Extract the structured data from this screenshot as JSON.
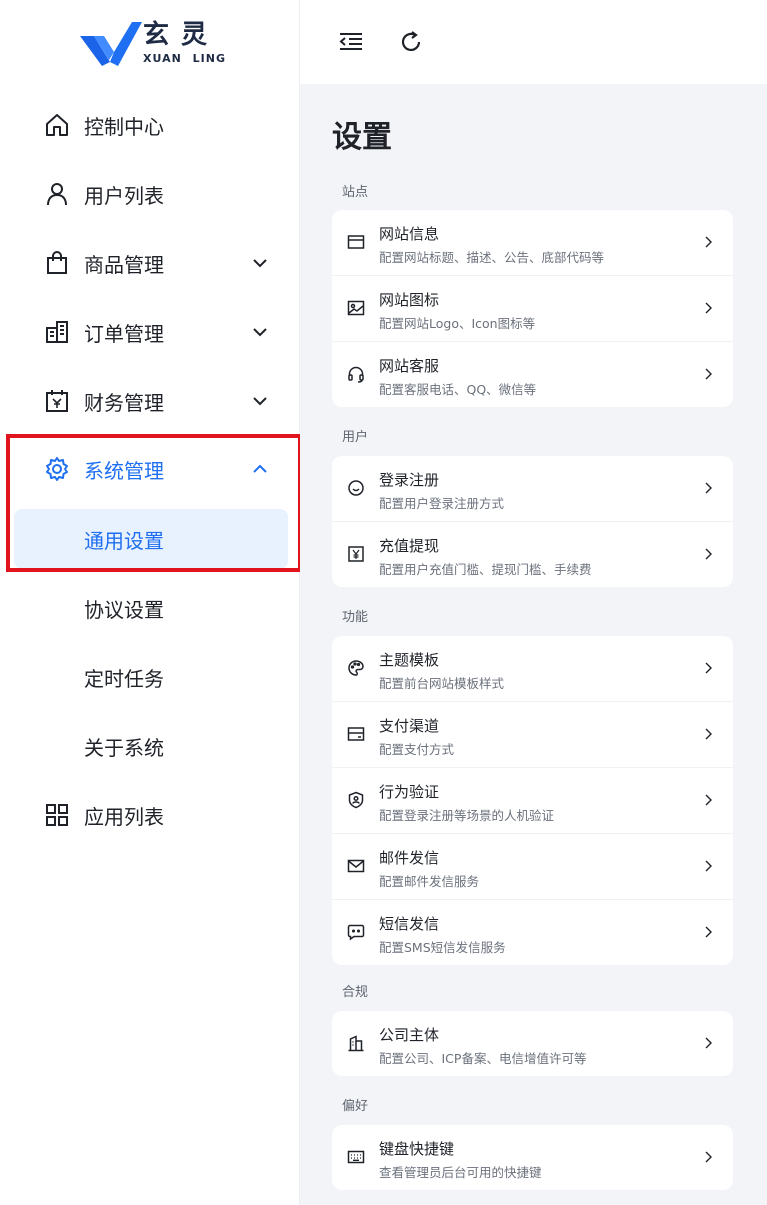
{
  "brand": {
    "cn": "玄灵",
    "en_left": "XUAN",
    "en_right": "LING",
    "color": "#1e6ff1"
  },
  "sidebar": {
    "items": [
      {
        "label": "控制中心",
        "icon": "home-icon"
      },
      {
        "label": "用户列表",
        "icon": "user-icon"
      },
      {
        "label": "商品管理",
        "icon": "shopping-bag-icon",
        "expandable": true
      },
      {
        "label": "订单管理",
        "icon": "building-icon",
        "expandable": true
      },
      {
        "label": "财务管理",
        "icon": "calendar-yen-icon",
        "expandable": true
      },
      {
        "label": "系统管理",
        "icon": "gear-icon",
        "expandable": true,
        "expanded": true
      },
      {
        "label": "应用列表",
        "icon": "grid-icon"
      }
    ],
    "system_sub": [
      {
        "label": "通用设置",
        "selected": true
      },
      {
        "label": "协议设置"
      },
      {
        "label": "定时任务"
      },
      {
        "label": "关于系统"
      }
    ]
  },
  "topbar": {
    "collapse_icon": "menu-collapse-icon",
    "refresh_icon": "refresh-icon"
  },
  "page": {
    "title": "设置"
  },
  "sections": [
    {
      "label": "站点",
      "rows": [
        {
          "title": "网站信息",
          "desc": "配置网站标题、描述、公告、底部代码等",
          "icon": "browser-window-icon"
        },
        {
          "title": "网站图标",
          "desc": "配置网站Logo、Icon图标等",
          "icon": "image-icon"
        },
        {
          "title": "网站客服",
          "desc": "配置客服电话、QQ、微信等",
          "icon": "headset-icon"
        }
      ]
    },
    {
      "label": "用户",
      "rows": [
        {
          "title": "登录注册",
          "desc": "配置用户登录注册方式",
          "icon": "smile-icon"
        },
        {
          "title": "充值提现",
          "desc": "配置用户充值门槛、提现门槛、手续费",
          "icon": "yen-icon"
        }
      ]
    },
    {
      "label": "功能",
      "rows": [
        {
          "title": "主题模板",
          "desc": "配置前台网站模板样式",
          "icon": "palette-icon"
        },
        {
          "title": "支付渠道",
          "desc": "配置支付方式",
          "icon": "card-icon"
        },
        {
          "title": "行为验证",
          "desc": "配置登录注册等场景的人机验证",
          "icon": "shield-user-icon"
        },
        {
          "title": "邮件发信",
          "desc": "配置邮件发信服务",
          "icon": "mail-icon"
        },
        {
          "title": "短信发信",
          "desc": "配置SMS短信发信服务",
          "icon": "message-icon"
        }
      ]
    },
    {
      "label": "合规",
      "rows": [
        {
          "title": "公司主体",
          "desc": "配置公司、ICP备案、电信增值许可等",
          "icon": "company-icon"
        }
      ]
    },
    {
      "label": "偏好",
      "rows": [
        {
          "title": "键盘快捷键",
          "desc": "查看管理员后台可用的快捷键",
          "icon": "keyboard-icon"
        }
      ]
    }
  ],
  "colors": {
    "accent": "#1e6ff1",
    "highlight": "#e0141c",
    "bg": "#f3f4f7"
  }
}
